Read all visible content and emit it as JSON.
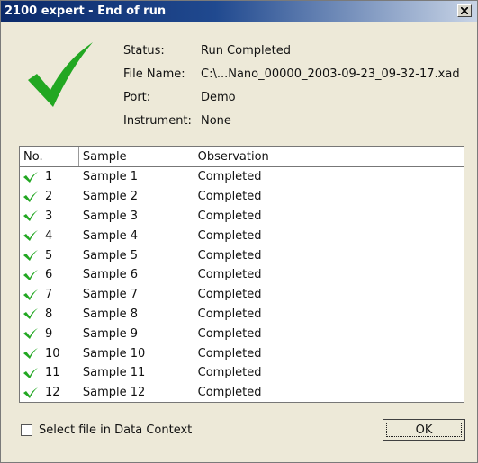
{
  "window": {
    "title": "2100 expert - End of run"
  },
  "info": {
    "status_label": "Status:",
    "status_value": "Run Completed",
    "file_label": "File Name:",
    "file_value": "C:\\...Nano_00000_2003-09-23_09-32-17.xad",
    "port_label": "Port:",
    "port_value": "Demo",
    "instrument_label": "Instrument:",
    "instrument_value": "None"
  },
  "table": {
    "headers": [
      "No.",
      "Sample",
      "Observation"
    ],
    "rows": [
      {
        "no": "1",
        "sample": "Sample 1",
        "observation": "Completed"
      },
      {
        "no": "2",
        "sample": "Sample 2",
        "observation": "Completed"
      },
      {
        "no": "3",
        "sample": "Sample 3",
        "observation": "Completed"
      },
      {
        "no": "4",
        "sample": "Sample 4",
        "observation": "Completed"
      },
      {
        "no": "5",
        "sample": "Sample 5",
        "observation": "Completed"
      },
      {
        "no": "6",
        "sample": "Sample 6",
        "observation": "Completed"
      },
      {
        "no": "7",
        "sample": "Sample 7",
        "observation": "Completed"
      },
      {
        "no": "8",
        "sample": "Sample 8",
        "observation": "Completed"
      },
      {
        "no": "9",
        "sample": "Sample 9",
        "observation": "Completed"
      },
      {
        "no": "10",
        "sample": "Sample 10",
        "observation": "Completed"
      },
      {
        "no": "11",
        "sample": "Sample 11",
        "observation": "Completed"
      },
      {
        "no": "12",
        "sample": "Sample 12",
        "observation": "Completed"
      }
    ]
  },
  "footer": {
    "checkbox_label": "Select file in Data Context",
    "checkbox_checked": false,
    "ok_label": "OK"
  },
  "colors": {
    "check_green": "#22a722",
    "titlebar": "#0b2a6a",
    "dialog_bg": "#ede9d8"
  },
  "icons": {
    "status": "checkmark-icon",
    "row_status": "checkmark-icon",
    "close": "close-icon"
  }
}
